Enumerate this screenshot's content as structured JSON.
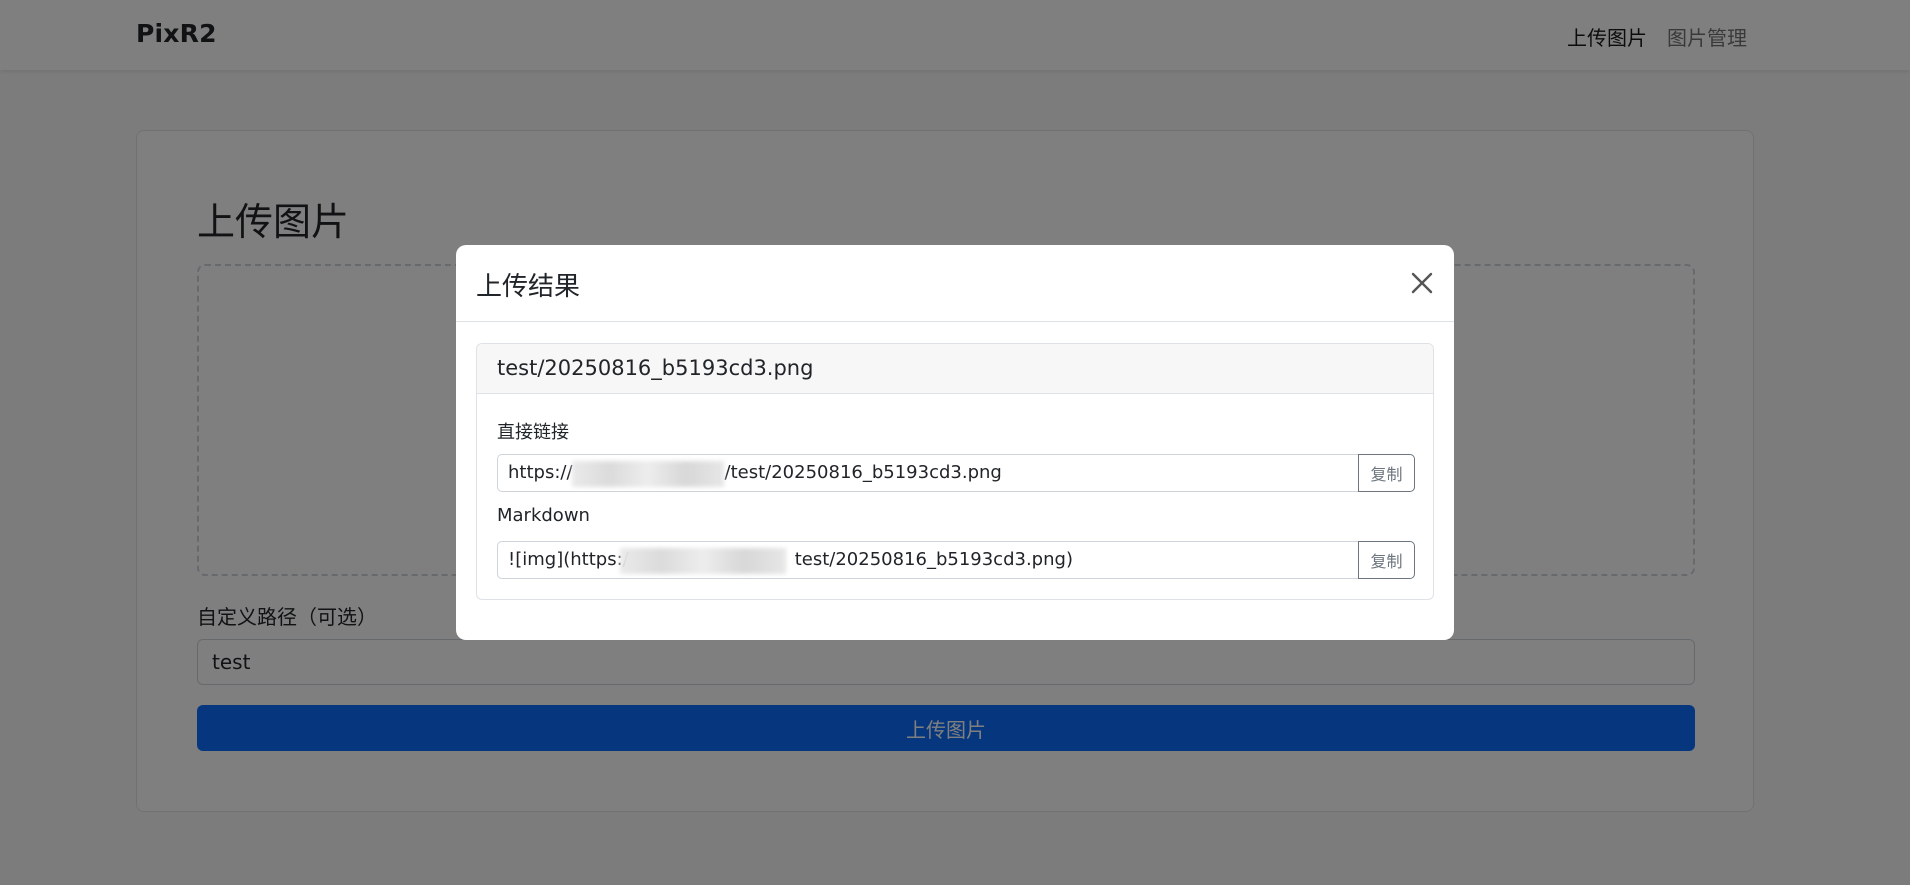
{
  "navbar": {
    "brand": "PixR2",
    "links": [
      {
        "label": "上传图片",
        "active": true
      },
      {
        "label": "图片管理",
        "active": false
      }
    ]
  },
  "upload_card": {
    "title": "上传图片",
    "path_label": "自定义路径（可选）",
    "path_value": "test",
    "upload_button": "上传图片"
  },
  "modal": {
    "title": "上传结果",
    "filename": "test/20250816_b5193cd3.png",
    "direct_link": {
      "label": "直接链接",
      "prefix": "https://",
      "suffix": "/test/20250816_b5193cd3.png",
      "copy_label": "复制"
    },
    "markdown": {
      "label": "Markdown",
      "prefix": "![img](https:/",
      "suffix": "test/20250816_b5193cd3.png)",
      "copy_label": "复制"
    }
  },
  "colors": {
    "primary": "#0d6efd",
    "backdrop": "rgba(0,0,0,0.5)",
    "secondary": "#6c757d"
  },
  "icons": {
    "close": "close-icon"
  }
}
